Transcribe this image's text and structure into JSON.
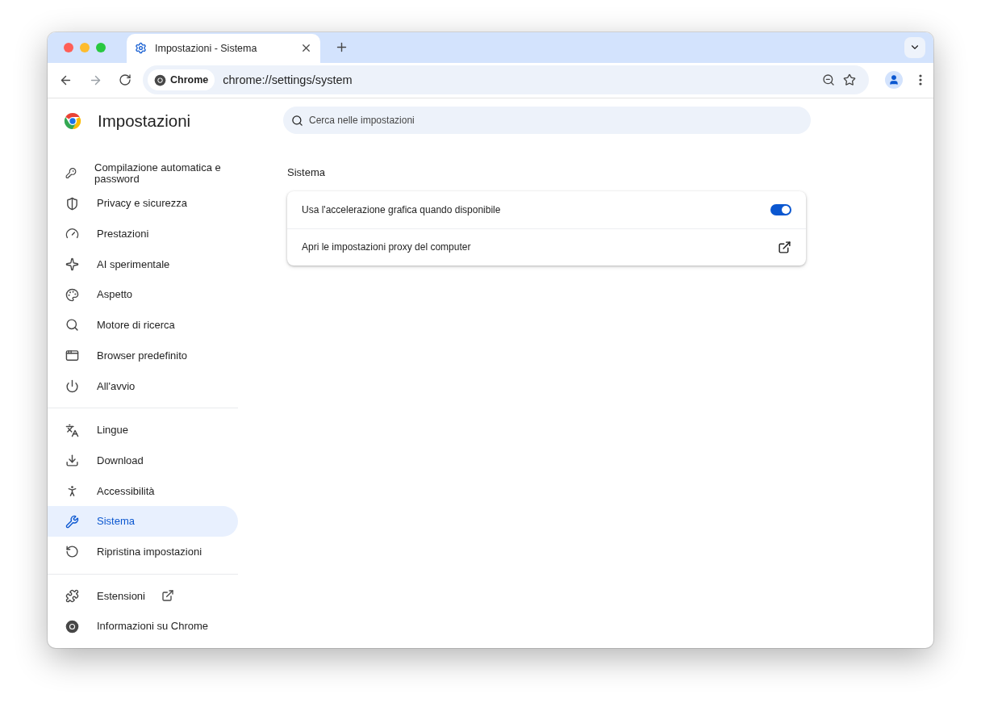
{
  "tab": {
    "title": "Impostazioni - Sistema",
    "selected": true
  },
  "address_bar": {
    "chip": "Chrome",
    "url": "chrome://settings/system"
  },
  "sidebar": {
    "title": "Impostazioni",
    "sections": [
      [
        {
          "label": "Compilazione automatica e password",
          "selected": false,
          "external": false
        },
        {
          "label": "Privacy e sicurezza",
          "selected": false,
          "external": false
        },
        {
          "label": "Prestazioni",
          "selected": false,
          "external": false
        },
        {
          "label": "AI sperimentale",
          "selected": false,
          "external": false
        },
        {
          "label": "Aspetto",
          "selected": false,
          "external": false
        },
        {
          "label": "Motore di ricerca",
          "selected": false,
          "external": false
        },
        {
          "label": "Browser predefinito",
          "selected": false,
          "external": false
        },
        {
          "label": "All'avvio",
          "selected": false,
          "external": false
        }
      ],
      [
        {
          "label": "Lingue",
          "selected": false,
          "external": false
        },
        {
          "label": "Download",
          "selected": false,
          "external": false
        },
        {
          "label": "Accessibilità",
          "selected": false,
          "external": false
        },
        {
          "label": "Sistema",
          "selected": true,
          "external": false
        },
        {
          "label": "Ripristina impostazioni",
          "selected": false,
          "external": false
        }
      ],
      [
        {
          "label": "Estensioni",
          "selected": false,
          "external": true
        },
        {
          "label": "Informazioni su Chrome",
          "selected": false,
          "external": false
        }
      ]
    ]
  },
  "search": {
    "placeholder": "Cerca nelle impostazioni"
  },
  "section": {
    "title": "Sistema",
    "rows": [
      {
        "kind": "toggle",
        "label": "Usa l'accelerazione grafica quando disponibile",
        "on": true
      },
      {
        "kind": "link",
        "label": "Apri le impostazioni proxy del computer"
      }
    ]
  }
}
